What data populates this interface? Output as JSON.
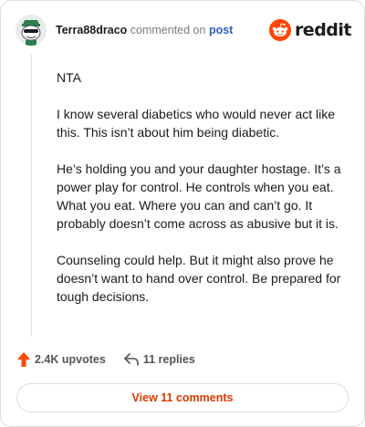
{
  "header": {
    "username": "Terra88draco",
    "action_text": "commented on",
    "post_link": "post",
    "brand_name": "reddit"
  },
  "comment": {
    "paragraphs": [
      "NTA",
      "I know several diabetics who would never act like this. This isn’t about him being diabetic.",
      "He’s holding you and your daughter hostage. It’s a power play for control. He controls when you eat. What you eat. Where you can and can’t go. It probably doesn’t come across as abusive but it is.",
      "Counseling could help. But it might also prove he doesn’t want to hand over control. Be prepared for tough decisions."
    ]
  },
  "footer": {
    "upvotes": "2.4K upvotes",
    "replies": "11 replies",
    "view_comments": "View 11 comments"
  },
  "colors": {
    "brand": "#ff4500",
    "link": "#2b5fbf",
    "view_comments": "#d93a00"
  },
  "icons": {
    "avatar": "snoo-avatar",
    "brand": "reddit-logo-icon",
    "upvote": "upvote-arrow-icon",
    "reply": "reply-arrow-icon"
  }
}
